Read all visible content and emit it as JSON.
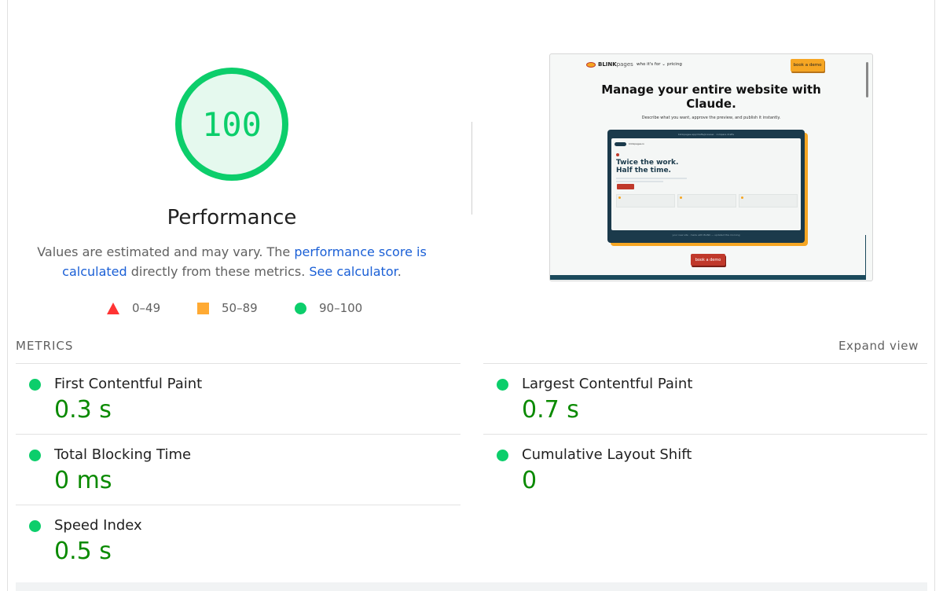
{
  "score": {
    "value": "100",
    "title": "Performance",
    "ring_color": "#0cce6b",
    "ring_fill": "#e5f9ee",
    "fraction": 1.0
  },
  "description": {
    "text_1": "Values are estimated and may vary. The ",
    "link_1": "performance score is calculated",
    "text_2": " directly from these metrics. ",
    "link_2": "See calculator",
    "text_3": "."
  },
  "legend": [
    {
      "icon": "red-triangle-icon",
      "range": "0–49",
      "color": "#ff3333"
    },
    {
      "icon": "orange-square-icon",
      "range": "50–89",
      "color": "#ffaa33"
    },
    {
      "icon": "green-circle-icon",
      "range": "90–100",
      "color": "#0cce6b"
    }
  ],
  "screenshot": {
    "brand": "BLINK",
    "brand_suffix": "pages",
    "nav_link_1": "who it's for ⌄",
    "nav_link_2": "pricing",
    "nav_cta": "book a demo",
    "headline": "Manage your entire website with Claude.",
    "subline": "Describe what you want, approve the preview, and publish it instantly.",
    "device_bar": "blinkpages.app/drafts/preview · compare drafts",
    "inner_small": "blinkpages.io",
    "inner_headline_1": "Twice the work.",
    "inner_headline_2": "Half the time.",
    "device_footer": "your new site · made with BLINK — updated this morning",
    "demo_button": "book a demo"
  },
  "metrics": {
    "section_title": "METRICS",
    "expand_label": "Expand view",
    "items": [
      {
        "name": "First Contentful Paint",
        "value": "0.3 s"
      },
      {
        "name": "Largest Contentful Paint",
        "value": "0.7 s"
      },
      {
        "name": "Total Blocking Time",
        "value": "0 ms"
      },
      {
        "name": "Cumulative Layout Shift",
        "value": "0"
      },
      {
        "name": "Speed Index",
        "value": "0.5 s"
      }
    ],
    "good_color": "#0a8a00"
  }
}
